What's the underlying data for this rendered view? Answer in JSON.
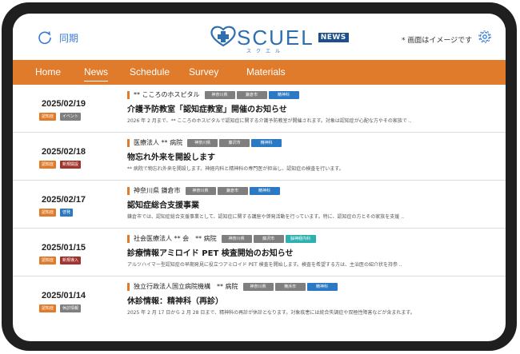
{
  "header": {
    "sync_label": "同期",
    "logo_text": "SCUEL",
    "logo_badge": "NEWS",
    "logo_kana": "スクエル",
    "note": "* 画面はイメージです"
  },
  "nav": [
    {
      "label": "Home"
    },
    {
      "label": "News",
      "active": true
    },
    {
      "label": "Schedule"
    },
    {
      "label": "Survey"
    },
    {
      "label": "Materials"
    }
  ],
  "colors": {
    "nav_bg": "#e07b2c",
    "orange_tag": "#e07b2c",
    "gray_tag": "#7f7f7f",
    "blue_tag": "#2b79c2",
    "teal_tag": "#2db0b0",
    "red_tag": "#a2342e"
  },
  "news": [
    {
      "date": "2025/02/19",
      "tags": [
        {
          "label": "認知症",
          "color": "#e07b2c"
        },
        {
          "label": "イベント",
          "color": "#7f7f7f"
        }
      ],
      "org": "** こころのホスピタル",
      "locations": [
        {
          "label": "神奈川県",
          "style": "gray"
        },
        {
          "label": "鎌倉市",
          "style": "gray"
        },
        {
          "label": "精神科",
          "style": "blue"
        }
      ],
      "title": "介護予防教室「認知症教室」開催のお知らせ",
      "desc": "2026 年 2 月まで、** こころのホスピタルで認知症に関する介護予防教室が開催されます。対象は認知症が心配な方やその家族で .."
    },
    {
      "date": "2025/02/18",
      "tags": [
        {
          "label": "認知症",
          "color": "#e07b2c"
        },
        {
          "label": "新規開設",
          "color": "#a2342e"
        }
      ],
      "org": "医療法人 ** 病院",
      "locations": [
        {
          "label": "神奈川県",
          "style": "gray"
        },
        {
          "label": "藤沢市",
          "style": "gray"
        },
        {
          "label": "精神科",
          "style": "blue"
        }
      ],
      "title": "物忘れ外来を開設します",
      "desc": "** 病院で物忘れ外来を開設します。神経内科と精神科の専門医が担当し、認知症の検査を行います。"
    },
    {
      "date": "2025/02/17",
      "tags": [
        {
          "label": "認知症",
          "color": "#e07b2c"
        },
        {
          "label": "啓発",
          "color": "#2b79c2"
        }
      ],
      "org": "神奈川県 鎌倉市",
      "locations": [
        {
          "label": "神奈川県",
          "style": "gray"
        },
        {
          "label": "鎌倉市",
          "style": "gray"
        },
        {
          "label": "精神科",
          "style": "blue"
        }
      ],
      "title": "認知症総合支援事業",
      "desc": "鎌倉市では、認知症総合支援事業として、認知症に関する講座や啓発活動を行っています。特に、認知症の方とその家族を支援 .."
    },
    {
      "date": "2025/01/15",
      "tags": [
        {
          "label": "認知症",
          "color": "#e07b2c"
        },
        {
          "label": "新規導入",
          "color": "#a2342e"
        }
      ],
      "org": "社会医療法人 ** 会　** 病院",
      "locations": [
        {
          "label": "神奈川県",
          "style": "gray"
        },
        {
          "label": "藤沢市",
          "style": "gray"
        },
        {
          "label": "脳神経内科",
          "style": "teal"
        }
      ],
      "title": "診療情報アミロイド PET 検査開始のお知らせ",
      "desc": "アルツハイマー型認知症の早期発見に役立つアミロイド PET 検査を開始します。検査を希望する方は、主治医の紹介状を持参 .."
    },
    {
      "date": "2025/01/14",
      "tags": [
        {
          "label": "認知症",
          "color": "#e07b2c"
        },
        {
          "label": "休診情報",
          "color": "#7f7f7f"
        }
      ],
      "org": "独立行政法人国立病院機構　** 病院",
      "locations": [
        {
          "label": "神奈川県",
          "style": "gray"
        },
        {
          "label": "横浜市",
          "style": "gray"
        },
        {
          "label": "精神科",
          "style": "blue"
        }
      ],
      "title": "休診情報：精神科（再診）",
      "desc": "2025 年 2 月 17 日から 2 月 28 日まで、精神科の再診が休診となります。対象疾患には統合失調症や双極性障害などが含まれます。"
    }
  ]
}
